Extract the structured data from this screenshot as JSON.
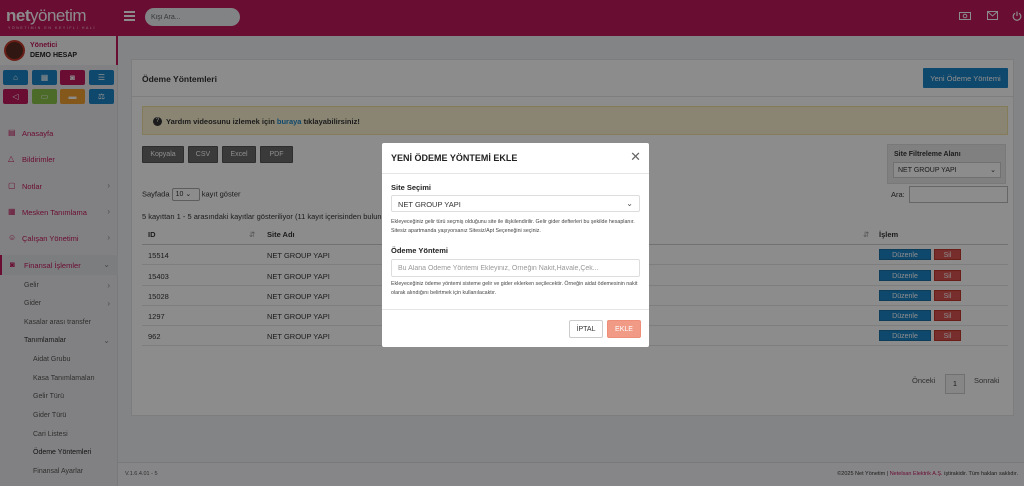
{
  "app": {
    "logo_main": "net",
    "logo_accent": "yönetim",
    "logo_sub": "YÖNETİMİN EN KEYİFLİ HALİ",
    "search_placeholder": "Kişi Ara..."
  },
  "user": {
    "role": "Yönetici",
    "name": "DEMO HESAP"
  },
  "colors": {
    "brand": "#c2185b",
    "primary": "#1c84c6",
    "danger": "#d9534f",
    "accent_button": "#f19a86"
  },
  "quick_tiles": [
    {
      "icon": "home-icon",
      "color": "#1c84c6"
    },
    {
      "icon": "building-icon",
      "color": "#1c84c6"
    },
    {
      "icon": "money-icon",
      "color": "#c2185b"
    },
    {
      "icon": "contacts-icon",
      "color": "#1c84c6"
    },
    {
      "icon": "megaphone-icon",
      "color": "#c2185b"
    },
    {
      "icon": "inbox-icon",
      "color": "#8bc34a"
    },
    {
      "icon": "card-icon",
      "color": "#f0a030"
    },
    {
      "icon": "balance-icon",
      "color": "#1c84c6"
    }
  ],
  "nav": [
    {
      "label": "Anasayfa",
      "icon": "dashboard-icon",
      "chevron": false
    },
    {
      "label": "Bildirimler",
      "icon": "bell-icon",
      "chevron": false
    },
    {
      "label": "Notlar",
      "icon": "note-icon",
      "chevron": true
    },
    {
      "label": "Mesken Tanımlama",
      "icon": "building-icon",
      "chevron": true
    },
    {
      "label": "Çalışan Yönetimi",
      "icon": "people-icon",
      "chevron": true
    },
    {
      "label": "Finansal İşlemler",
      "icon": "money-icon",
      "chevron": true
    }
  ],
  "subnav": [
    {
      "label": "Gelir",
      "chevron": true
    },
    {
      "label": "Gider",
      "chevron": true
    },
    {
      "label": "Kasalar arası transfer",
      "chevron": false
    },
    {
      "label": "Tanımlamalar",
      "chevron": true
    }
  ],
  "subsubnav": [
    "Aidat Grubu",
    "Kasa Tanımlamaları",
    "Gelir Türü",
    "Gider Türü",
    "Cari Listesi",
    "Ödeme Yöntemleri",
    "Finansal Ayarlar"
  ],
  "page": {
    "title": "Ödeme Yöntemleri",
    "new_button": "Yeni Ödeme Yöntemi",
    "alert_pre": "Yardım videosunu izlemek için ",
    "alert_link": "buraya",
    "alert_post": " tıklayabilirsiniz!",
    "export_buttons": [
      "Kopyala",
      "CSV",
      "Excel",
      "PDF"
    ],
    "filter_label": "Site Filtreleme Alanı",
    "filter_value": "NET GROUP YAPI",
    "page_size_pre": "Sayfada",
    "page_size": "10",
    "page_size_post": "kayıt göster",
    "search_label": "Ara:",
    "info": "5 kayıttan 1 - 5 arasındaki kayıtlar gösteriliyor (11 kayıt içerisinden bulun",
    "columns": [
      "ID",
      "Site Adı",
      "İşlem"
    ],
    "rows": [
      {
        "id": "15514",
        "site": "NET GROUP YAPI"
      },
      {
        "id": "15403",
        "site": "NET GROUP YAPI"
      },
      {
        "id": "15028",
        "site": "NET GROUP YAPI"
      },
      {
        "id": "1297",
        "site": "NET GROUP YAPI"
      },
      {
        "id": "962",
        "site": "NET GROUP YAPI"
      }
    ],
    "edit_label": "Düzenle",
    "delete_label": "Sil",
    "pager_prev": "Önceki",
    "pager_current": "1",
    "pager_next": "Sonraki"
  },
  "footer": {
    "version": "V.1.6.4.01 - 5",
    "copy_pre": "©2025 Net Yönetim |",
    "copy_link": "Netelsan Elektrik A.Ş.",
    "copy_post": " iştirakidir. Tüm hakları saklıdır."
  },
  "modal": {
    "title": "YENİ ÖDEME YÖNTEMİ EKLE",
    "site_label": "Site Seçimi",
    "site_value": "NET GROUP YAPI",
    "site_help": "Ekleyeceğiniz gelir türü seçmiş olduğunu site ile ilişkilendirilir. Gelir gider defterleri bu şekilde hesaplanır. Sitesiz apartmanda yaşıyorsanız Sitesiz/Apt Seçeneğini seçiniz.",
    "method_label": "Ödeme Yöntemi",
    "method_placeholder": "Bu Alana Ödeme Yöntemi Ekleyiniz, Örneğin Nakit,Havale,Çek...",
    "method_help": "Ekleyeceğiniz ödeme yöntemi sisteme gelir ve gider eklerken seçilecektir. Örneğin aidat ödemesinin nakit olarak alındığını belirtmek için kullanılacaktır.",
    "cancel_label": "İPTAL",
    "add_label": "EKLE"
  }
}
